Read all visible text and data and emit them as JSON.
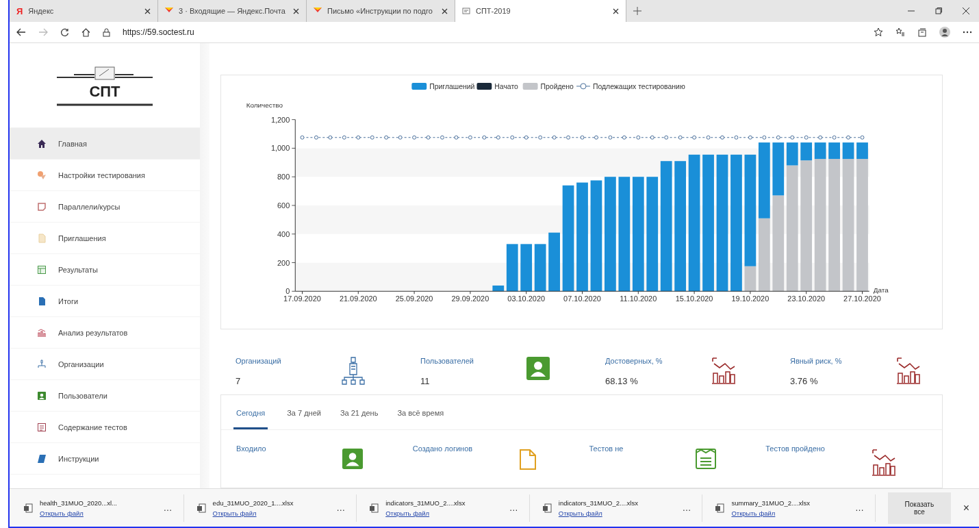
{
  "browser": {
    "tabs": [
      {
        "favicon_letter": "Я",
        "title": "Яндекс",
        "selected": false
      },
      {
        "title": "3 · Входящие — Яндекс.Почта",
        "selected": false
      },
      {
        "title": "Письмо «Инструкции по подго",
        "selected": false
      },
      {
        "title": "СПТ-2019",
        "selected": true
      }
    ],
    "url": "https://59.soctest.ru"
  },
  "sidebar": {
    "logo": "СПТ",
    "items": [
      {
        "label": "Главная",
        "selected": true
      },
      {
        "label": "Настройки тестирования",
        "selected": false
      },
      {
        "label": "Параллели/курсы",
        "selected": false
      },
      {
        "label": "Приглашения",
        "selected": false
      },
      {
        "label": "Результаты",
        "selected": false
      },
      {
        "label": "Итоги",
        "selected": false
      },
      {
        "label": "Анализ результатов",
        "selected": false
      },
      {
        "label": "Организации",
        "selected": false
      },
      {
        "label": "Пользователи",
        "selected": false
      },
      {
        "label": "Содержание тестов",
        "selected": false
      },
      {
        "label": "Инструкции",
        "selected": false
      }
    ]
  },
  "chart": {
    "chart_data": {
      "type": "bar",
      "stacked": true,
      "legend": "top",
      "xlabel": "Дата",
      "ylabel": "Количество",
      "ylim": [
        0,
        1200
      ],
      "yticks": [
        {
          "value": 0,
          "label": "0"
        },
        {
          "value": 200,
          "label": "200"
        },
        {
          "value": 400,
          "label": "400"
        },
        {
          "value": 600,
          "label": "600"
        },
        {
          "value": 800,
          "label": "800"
        },
        {
          "value": 1000,
          "label": "1,000"
        },
        {
          "value": 1200,
          "label": "1,200"
        }
      ],
      "categories": [
        "17.09.2020",
        null,
        null,
        null,
        "21.09.2020",
        null,
        null,
        null,
        "25.09.2020",
        null,
        null,
        null,
        "29.09.2020",
        null,
        null,
        null,
        "03.10.2020",
        null,
        null,
        null,
        "07.10.2020",
        null,
        null,
        null,
        "11.10.2020",
        null,
        null,
        null,
        "15.10.2020",
        null,
        null,
        null,
        "19.10.2020",
        null,
        null,
        null,
        "23.10.2020",
        null,
        null,
        null,
        "27.10.2020"
      ],
      "series": [
        {
          "name": "Приглашений",
          "color": "#1a8fd8",
          "values": [
            0,
            0,
            0,
            0,
            0,
            0,
            0,
            0,
            0,
            0,
            0,
            0,
            0,
            0,
            40,
            330,
            330,
            330,
            410,
            740,
            760,
            775,
            800,
            800,
            800,
            800,
            910,
            910,
            955,
            955,
            955,
            955,
            780,
            530,
            370,
            160,
            125,
            115,
            115,
            115,
            115
          ]
        },
        {
          "name": "Начато",
          "color": "#1b2a3a",
          "values": [
            0,
            0,
            0,
            0,
            0,
            0,
            0,
            0,
            0,
            0,
            0,
            0,
            0,
            0,
            0,
            0,
            0,
            0,
            0,
            0,
            0,
            0,
            0,
            0,
            0,
            0,
            0,
            0,
            0,
            0,
            0,
            0,
            0,
            0,
            0,
            0,
            0,
            0,
            0,
            0,
            0
          ]
        },
        {
          "name": "Пройдено",
          "color": "#c3c5c9",
          "values": [
            0,
            0,
            0,
            0,
            0,
            0,
            0,
            0,
            0,
            0,
            0,
            0,
            0,
            0,
            0,
            0,
            0,
            0,
            0,
            0,
            0,
            0,
            0,
            0,
            0,
            0,
            0,
            0,
            0,
            0,
            0,
            0,
            175,
            510,
            670,
            880,
            915,
            925,
            925,
            925,
            925
          ]
        },
        {
          "name": "Подлежащих тестированию",
          "type": "line",
          "line_style": "dashed",
          "color": "#4a6f9a",
          "values": [
            1075,
            1075,
            1075,
            1075,
            1075,
            1075,
            1075,
            1075,
            1075,
            1075,
            1075,
            1075,
            1075,
            1075,
            1075,
            1075,
            1075,
            1075,
            1075,
            1075,
            1075,
            1075,
            1075,
            1075,
            1075,
            1075,
            1075,
            1075,
            1075,
            1075,
            1075,
            1075,
            1075,
            1075,
            1075,
            1075,
            1075,
            1075,
            1075,
            1075,
            1075
          ]
        }
      ]
    }
  },
  "stats": [
    {
      "label": "Организаций",
      "value": "7"
    },
    {
      "label": "Пользователей",
      "value": "11"
    },
    {
      "label": "Достоверных, %",
      "value": "68.13 %"
    },
    {
      "label": "Явный риск, %",
      "value": "3.76 %"
    }
  ],
  "period": {
    "tabs": [
      {
        "label": "Сегодня",
        "selected": true
      },
      {
        "label": "За 7 дней",
        "selected": false
      },
      {
        "label": "За 21 день",
        "selected": false
      },
      {
        "label": "За всё время",
        "selected": false
      }
    ],
    "metrics": [
      {
        "label": "Входило"
      },
      {
        "label": "Создано логинов"
      },
      {
        "label": "Тестов не"
      },
      {
        "label": "Тестов пройдено"
      }
    ]
  },
  "downloads": {
    "items": [
      {
        "file": "health_31MUO_2020...xl...",
        "action": "Открыть файл"
      },
      {
        "file": "edu_31MUO_2020_1....xlsx",
        "action": "Открыть файл"
      },
      {
        "file": "indicators_31MUO_2....xlsx",
        "action": "Открыть файл"
      },
      {
        "file": "indicators_31MUO_2....xlsx",
        "action": "Открыть файл"
      },
      {
        "file": "summary_31MUO_2....xlsx",
        "action": "Открыть файл"
      }
    ],
    "more": "…",
    "show_all": "Показать все",
    "close": "×"
  }
}
